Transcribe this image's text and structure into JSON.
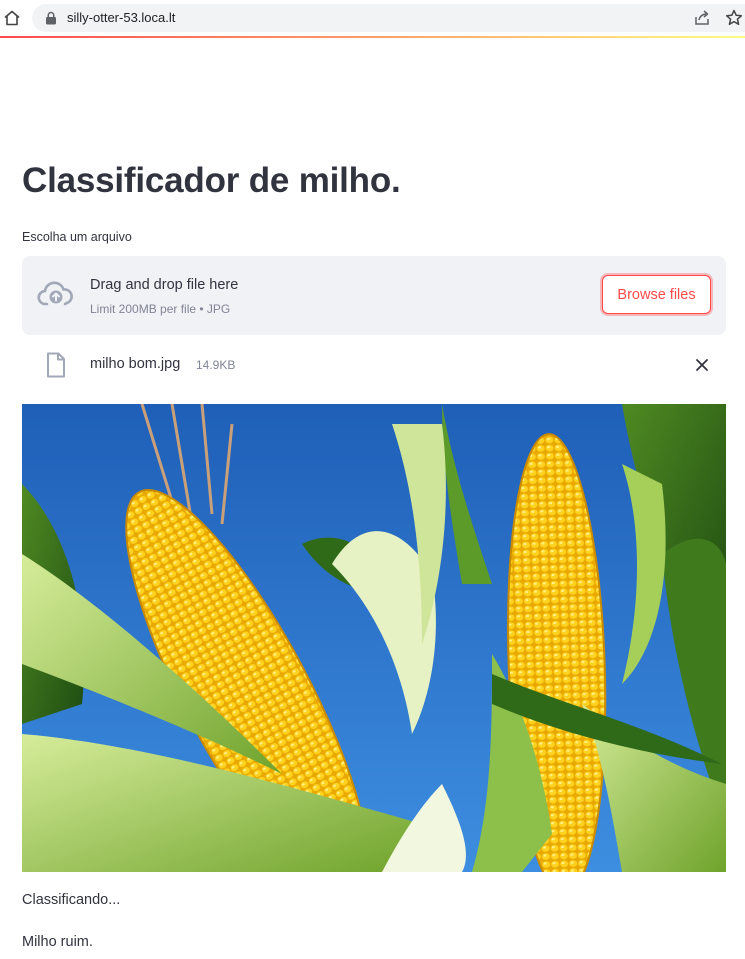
{
  "browser": {
    "url": "silly-otter-53.loca.lt",
    "icons": [
      "home-icon",
      "lock-icon",
      "share-icon",
      "star-icon"
    ]
  },
  "app": {
    "title": "Classificador de milho.",
    "accent_color": "#ff4b4b"
  },
  "uploader": {
    "label": "Escolha um arquivo",
    "drop_title": "Drag and drop file here",
    "drop_limit": "Limit 200MB per file • JPG",
    "browse_label": "Browse files",
    "icon": "cloud-upload-icon"
  },
  "uploaded_file": {
    "name": "milho bom.jpg",
    "size": "14.9KB",
    "icon": "file-icon",
    "remove_icon": "close-icon"
  },
  "image": {
    "subject": "corn cobs in field"
  },
  "output": {
    "status": "Classificando...",
    "result": "Milho ruim."
  }
}
